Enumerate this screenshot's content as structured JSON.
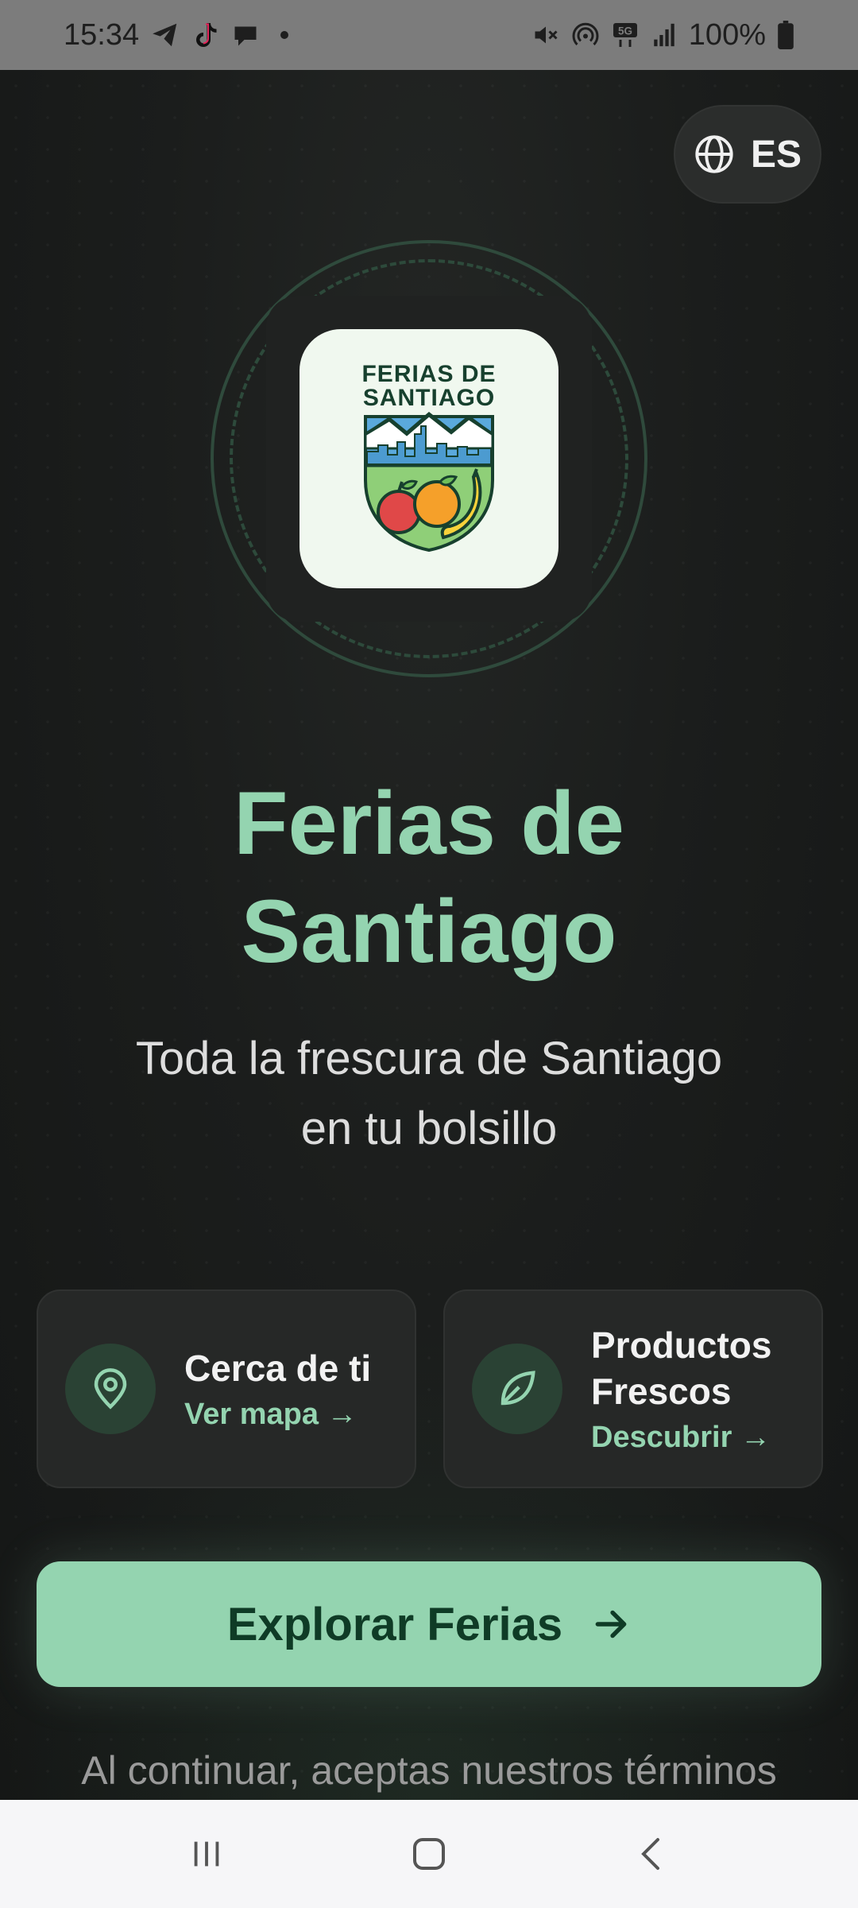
{
  "status_bar": {
    "time": "15:34",
    "battery": "100%",
    "icons": [
      "telegram-icon",
      "tiktok-icon",
      "chat-icon",
      "mute-icon",
      "hotspot-icon",
      "5g-icon",
      "signal-icon",
      "battery-icon"
    ]
  },
  "language": {
    "code": "ES",
    "icon": "globe-icon"
  },
  "logo": {
    "line1": "FERIAS DE",
    "line2": "SANTIAGO"
  },
  "title": {
    "line1": "Ferias de",
    "line2": "Santiago"
  },
  "subtitle": {
    "line1": "Toda la frescura de Santiago",
    "line2": "en tu bolsillo"
  },
  "cards": [
    {
      "title_line1": "Cerca de ti",
      "title_line2": "",
      "link": "Ver mapa →",
      "icon": "location-pin-icon"
    },
    {
      "title_line1": "Productos",
      "title_line2": "Frescos",
      "link": "Descubrir →",
      "icon": "leaf-icon"
    }
  ],
  "cta": {
    "label": "Explorar Ferias",
    "icon": "arrow-right-icon"
  },
  "terms": "Al continuar, aceptas nuestros términos",
  "colors": {
    "accent": "#94d4b0",
    "background": "#1a1c1b",
    "card": "#262827",
    "cta_text": "#0f3b26"
  },
  "nav": [
    "recents-icon",
    "home-icon",
    "back-icon"
  ]
}
